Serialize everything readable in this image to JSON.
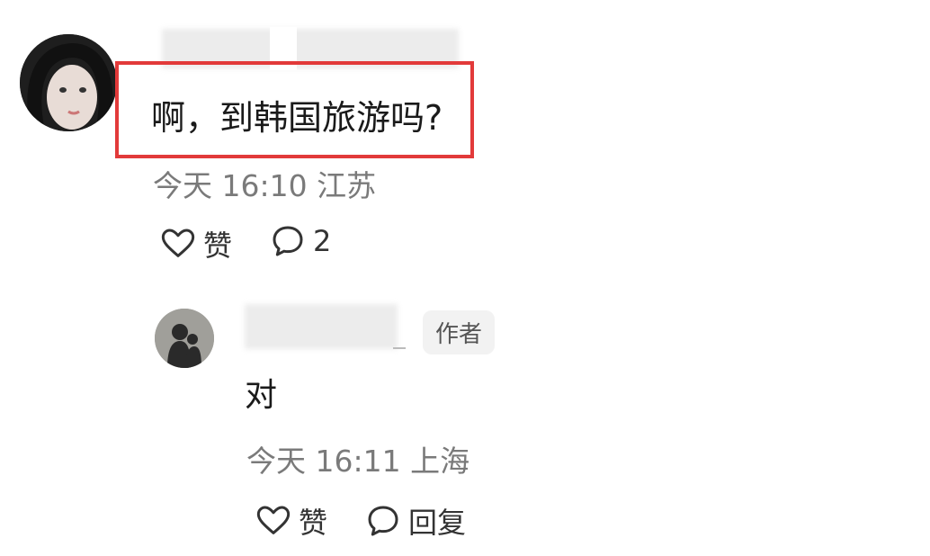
{
  "comment": {
    "text": "啊，到韩国旅游吗?",
    "meta": "今天 16:10 江苏",
    "like_label": "赞",
    "reply_count": "2"
  },
  "reply": {
    "author_badge": "作者",
    "text": "对",
    "meta": "今天 16:11 上海",
    "like_label": "赞",
    "reply_label": "回复"
  },
  "icons": {
    "like": "heart-outline-icon",
    "comment": "speech-bubble-icon"
  },
  "colors": {
    "highlight": "#e23a3a",
    "meta_text": "#7a7a7a"
  }
}
